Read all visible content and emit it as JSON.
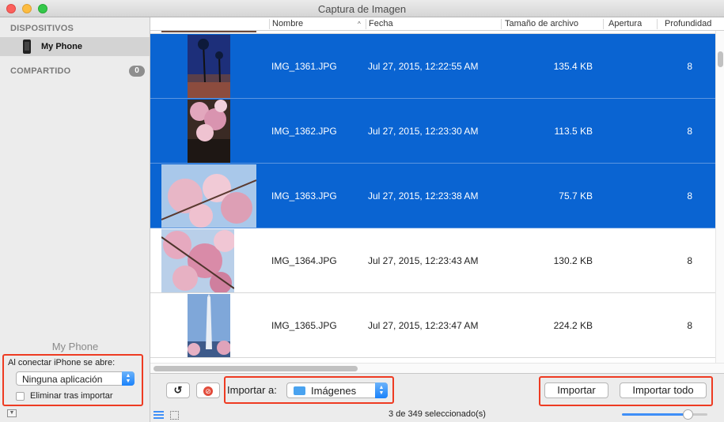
{
  "window": {
    "title": "Captura de Imagen"
  },
  "sidebar": {
    "devices_title": "DISPOSITIVOS",
    "device_name": "My Phone",
    "shared_title": "COMPARTIDO",
    "shared_count": "0",
    "device_footer": "My Phone",
    "on_connect_label": "Al conectar iPhone se abre:",
    "on_connect_value": "Ninguna aplicación",
    "delete_after_import": "Eliminar tras importar",
    "delete_after_import_checked": false
  },
  "table": {
    "headers": {
      "name": "Nombre",
      "date": "Fecha",
      "size": "Tamaño de archivo",
      "aperture": "Apertura",
      "depth": "Profundidad"
    },
    "rows": [
      {
        "name": "IMG_1361.JPG",
        "date": "Jul 27, 2015, 12:22:55 AM",
        "size": "135.4 KB",
        "depth": "8",
        "selected": true
      },
      {
        "name": "IMG_1362.JPG",
        "date": "Jul 27, 2015, 12:23:30 AM",
        "size": "113.5 KB",
        "depth": "8",
        "selected": true
      },
      {
        "name": "IMG_1363.JPG",
        "date": "Jul 27, 2015, 12:23:38 AM",
        "size": "75.7 KB",
        "depth": "8",
        "selected": true
      },
      {
        "name": "IMG_1364.JPG",
        "date": "Jul 27, 2015, 12:23:43 AM",
        "size": "130.2 KB",
        "depth": "8",
        "selected": false
      },
      {
        "name": "IMG_1365.JPG",
        "date": "Jul 27, 2015, 12:23:47 AM",
        "size": "224.2 KB",
        "depth": "8",
        "selected": false
      }
    ]
  },
  "toolbar": {
    "import_to_label": "Importar a:",
    "import_to_value": "Imágenes",
    "import_button": "Importar",
    "import_all_button": "Importar todo",
    "status": "3 de 349 seleccionado(s)",
    "rotate_icon": "rotate-left-icon",
    "delete_icon": "delete-icon"
  },
  "colors": {
    "selection": "#0a64d2",
    "highlight_box": "#ee3b22",
    "accent": "#1a82fb"
  }
}
